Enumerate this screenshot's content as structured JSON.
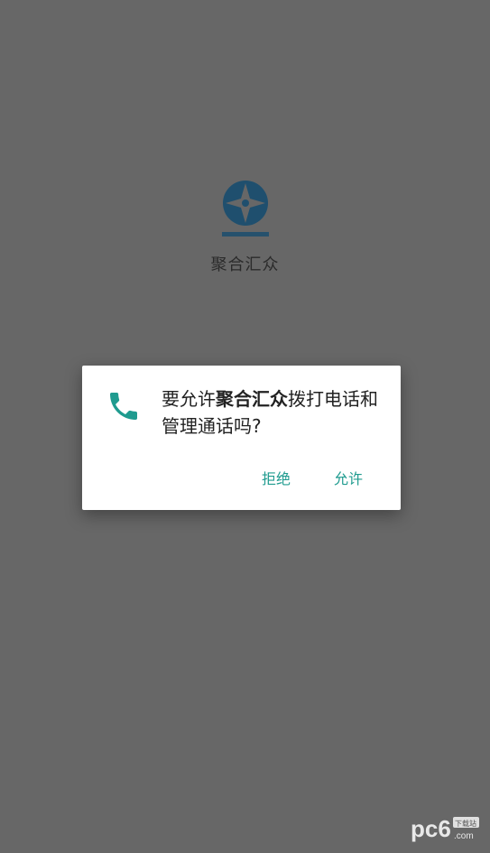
{
  "app": {
    "name": "聚合汇众"
  },
  "dialog": {
    "message_prefix": "要允许",
    "message_app": "聚合汇众",
    "message_suffix": "拨打电话和管理通话吗?",
    "deny_label": "拒绝",
    "allow_label": "允许",
    "icon": "phone-icon",
    "accent_color": "#1f9b8f"
  },
  "watermark": {
    "text": "pc6",
    "sub_text": "下载站",
    "domain": ".com"
  }
}
